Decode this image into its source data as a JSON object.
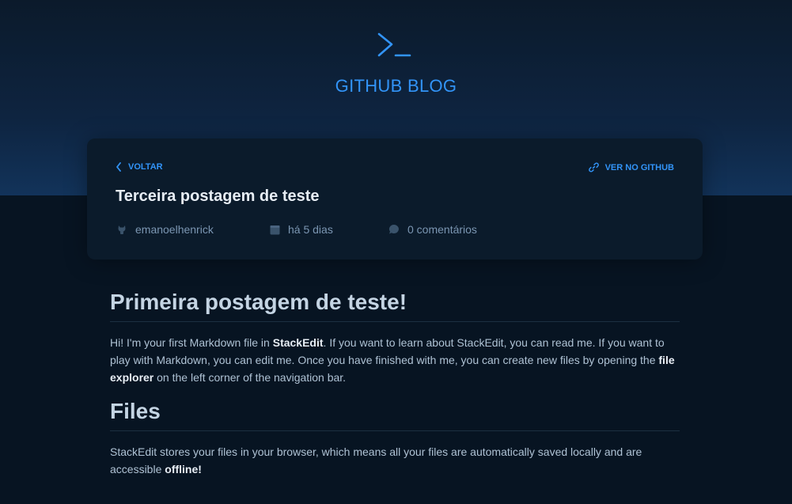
{
  "brand": {
    "title": "GITHUB BLOG",
    "logo_icon": "terminal-prompt-icon",
    "accent_color": "#3294f8"
  },
  "post_card": {
    "back_label": "VOLTAR",
    "github_label": "VER NO GITHUB",
    "title": "Terceira postagem de teste",
    "author": "emanoelhenrick",
    "date": "há 5 dias",
    "comments": "0 comentários"
  },
  "article": {
    "heading_1": "Primeira postagem de teste!",
    "p1": {
      "t1": "Hi! I'm your first Markdown file in ",
      "b1": "StackEdit",
      "t2": ". If you want to learn about StackEdit, you can read me. If you want to play with Markdown, you can edit me. Once you have finished with me, you can create new files by opening the ",
      "b2": "file explorer",
      "t3": " on the left corner of the navigation bar."
    },
    "heading_2": "Files",
    "p2": {
      "t1": "StackEdit stores your files in your browser, which means all your files are automatically saved locally and are accessible ",
      "b1": "offline!"
    }
  }
}
